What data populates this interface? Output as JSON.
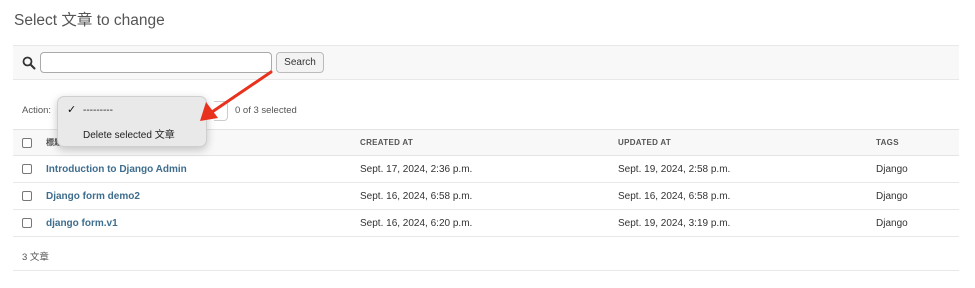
{
  "page": {
    "title": "Select 文章 to change"
  },
  "search": {
    "value": "",
    "placeholder": "",
    "button_label": "Search"
  },
  "actions": {
    "label": "Action:",
    "options": [
      {
        "label": "---------",
        "checked": true
      },
      {
        "label": "Delete selected 文章",
        "checked": false
      }
    ],
    "selected_count": "0 of 3 selected"
  },
  "table": {
    "headers": {
      "title": "標題",
      "created_at": "CREATED AT",
      "updated_at": "UPDATED AT",
      "tags": "TAGS"
    },
    "rows": [
      {
        "title": "Introduction to Django Admin",
        "created_at": "Sept. 17, 2024, 2:36 p.m.",
        "updated_at": "Sept. 19, 2024, 2:58 p.m.",
        "tags": "Django"
      },
      {
        "title": "Django form demo2",
        "created_at": "Sept. 16, 2024, 6:58 p.m.",
        "updated_at": "Sept. 16, 2024, 6:58 p.m.",
        "tags": "Django"
      },
      {
        "title": "django form.v1",
        "created_at": "Sept. 16, 2024, 6:20 p.m.",
        "updated_at": "Sept. 19, 2024, 3:19 p.m.",
        "tags": "Django"
      }
    ]
  },
  "footer": {
    "count": "3 文章"
  },
  "colors": {
    "link": "#3e6d8e",
    "annotation_arrow": "#e8321d",
    "toolbar_bg": "#f8f8f8"
  },
  "icons": {
    "search": "magnifier-icon",
    "check": "checkmark-icon"
  }
}
